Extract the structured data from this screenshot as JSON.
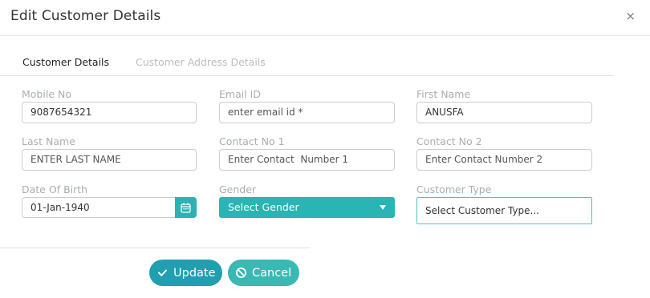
{
  "modal": {
    "title": "Edit Customer Details",
    "close_label": "×"
  },
  "tabs": [
    {
      "label": "Customer Details",
      "active": true
    },
    {
      "label": "Customer Address Details",
      "active": false
    }
  ],
  "fields": {
    "mobile": {
      "label": "Mobile No",
      "value": "9087654321"
    },
    "email": {
      "label": "Email ID",
      "placeholder": "enter email id *"
    },
    "first_name": {
      "label": "First Name",
      "value": "ANUSFA"
    },
    "last_name": {
      "label": "Last Name",
      "placeholder": "ENTER LAST NAME"
    },
    "contact1": {
      "label": "Contact No 1",
      "placeholder": "Enter Contact  Number 1"
    },
    "contact2": {
      "label": "Contact No 2",
      "placeholder": "Enter Contact Number 2"
    },
    "dob": {
      "label": "Date Of Birth",
      "value": "01-Jan-1940"
    },
    "gender": {
      "label": "Gender",
      "selected": "Select Gender"
    },
    "customer_type": {
      "label": "Customer Type",
      "selected": "Select Customer Type..."
    }
  },
  "buttons": {
    "update": "Update",
    "cancel": "Cancel"
  },
  "colors": {
    "accent": "#2ab4b4",
    "update_button": "#1f9fb0",
    "cancel_button": "#3ab8b4"
  },
  "icons": {
    "close": "close-icon",
    "calendar": "calendar-icon",
    "check": "check-icon",
    "cancel": "cancel-circle-icon",
    "caret": "chevron-down-icon"
  }
}
